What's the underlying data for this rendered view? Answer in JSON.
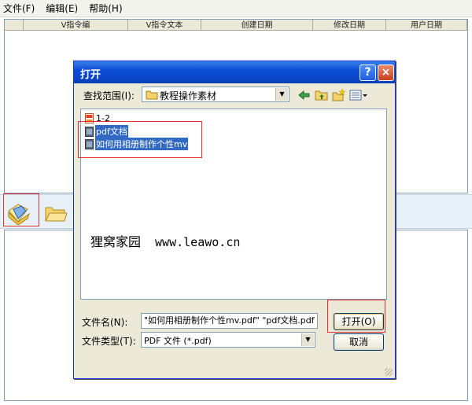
{
  "menu": [
    {
      "label": "文件(F)"
    },
    {
      "label": "编辑(E)"
    },
    {
      "label": "帮助(H)"
    }
  ],
  "list_headers": [
    "V指令编",
    "V指令文本",
    "创建日期",
    "修改日期",
    "用户日期"
  ],
  "dialog": {
    "title": "打开",
    "help": "?",
    "close": "×",
    "lookin_label": "查找范围(I):",
    "lookin_value": "教程操作素材",
    "files": [
      {
        "name": "1-2",
        "selected": false
      },
      {
        "name": "pdf文档",
        "selected": true
      },
      {
        "name": "如何用相册制作个性mv",
        "selected": true
      }
    ],
    "watermark_brand": "狸窝家园",
    "watermark_url": "www.leawo.cn",
    "filename_label": "文件名(N):",
    "filename_value": "\"如何用相册制作个性mv.pdf\" \"pdf文档.pdf",
    "filetype_label": "文件类型(T):",
    "filetype_value": "PDF 文件 (*.pdf)",
    "open_label": "打开(O)",
    "cancel_label": "取消"
  },
  "colors": {
    "highlight_red": "#e03030",
    "selection_blue": "#316ac5",
    "titlebar_blue": "#0a4cd6"
  }
}
